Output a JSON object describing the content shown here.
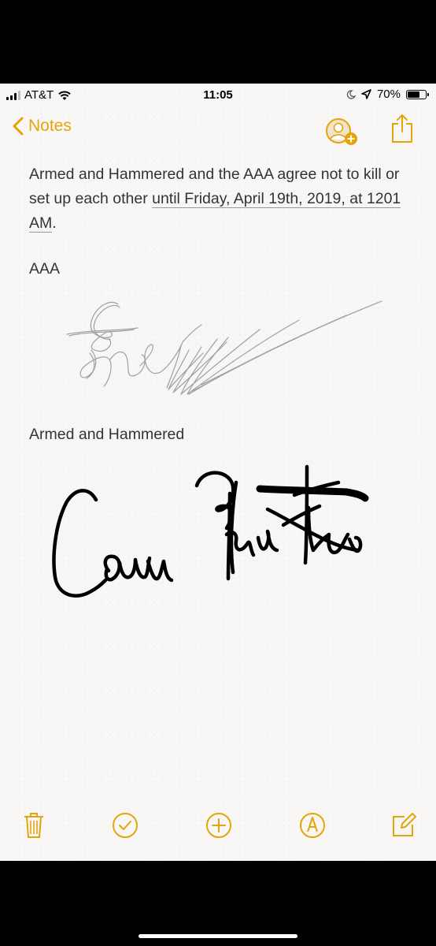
{
  "status_bar": {
    "carrier": "AT&T",
    "time": "11:05",
    "battery": "70%",
    "battery_level": 0.7
  },
  "nav": {
    "back_label": "Notes",
    "icons": [
      "chevron-left-icon",
      "add-people-icon",
      "share-icon"
    ]
  },
  "note": {
    "text_before_link": "Armed and Hammered and the AAA agree not to kill or set up each other ",
    "date_link": "until Friday, April 19th, 2019, at 1201 AM",
    "text_after_link": ".",
    "signatures": [
      {
        "label": "AAA",
        "style": "pencil",
        "color": "#9a9a9a"
      },
      {
        "label": "Armed and Hammered",
        "style": "pen",
        "color": "#000000"
      }
    ]
  },
  "toolbar": {
    "icons": [
      "trash-icon",
      "checklist-icon",
      "add-icon",
      "markup-pen-icon",
      "compose-icon"
    ]
  },
  "colors": {
    "accent": "#e5a50a",
    "paper": "#f8f7f5",
    "text": "#333333"
  }
}
